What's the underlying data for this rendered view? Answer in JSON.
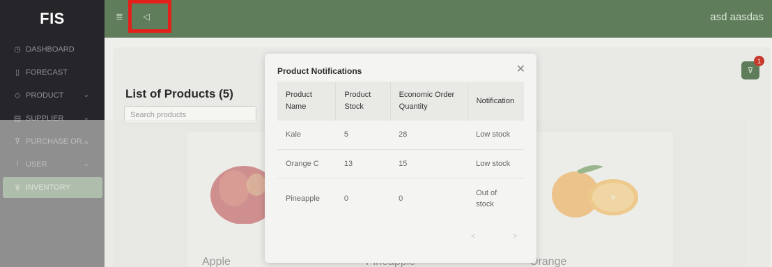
{
  "app": {
    "logo": "FIS"
  },
  "sidebar": {
    "items": [
      {
        "label": "DASHBOARD",
        "icon": "clock-icon",
        "glyph": "◷",
        "chevron": false
      },
      {
        "label": "FORECAST",
        "icon": "document-icon",
        "glyph": "▯",
        "chevron": false
      },
      {
        "label": "PRODUCT",
        "icon": "tag-icon",
        "glyph": "◇",
        "chevron": true
      },
      {
        "label": "SUPPLIER",
        "icon": "calendar-icon",
        "glyph": "▤",
        "chevron": true
      },
      {
        "label": "PURCHASE OR...",
        "icon": "cart-icon",
        "glyph": "⊽",
        "chevron": true
      },
      {
        "label": "USER",
        "icon": "user-icon",
        "glyph": "Ꭵ",
        "chevron": true
      },
      {
        "label": "INVENTORY",
        "icon": "cart-icon",
        "glyph": "⊽",
        "chevron": false,
        "active": true
      }
    ]
  },
  "topbar": {
    "user_name": "asd aasdas",
    "menu_glyph": "≣",
    "notification_glyph": "◁"
  },
  "main": {
    "title": "List of Products (5)",
    "search_placeholder": "Search products",
    "cart_badge": "1",
    "cart_glyph": "⊽",
    "products": [
      "Apple",
      "Pineapple",
      "Orange"
    ]
  },
  "modal": {
    "title": "Product Notifications",
    "close_glyph": "✕",
    "columns": [
      "Product Name",
      "Product Stock",
      "Economic Order Quantity",
      "Notification"
    ],
    "rows": [
      {
        "name": "Kale",
        "stock": "5",
        "eoq": "28",
        "notification": "Low stock"
      },
      {
        "name": "Orange C",
        "stock": "13",
        "eoq": "15",
        "notification": "Low stock"
      },
      {
        "name": "Pineapple",
        "stock": "0",
        "eoq": "0",
        "notification": "Out of stock"
      }
    ],
    "pager_prev": "<",
    "pager_next": ">"
  },
  "colors": {
    "sidebar": "#26262a",
    "topbar": "#5f7d5b",
    "accent": "#6e8d6a",
    "highlight": "#e4201b"
  }
}
